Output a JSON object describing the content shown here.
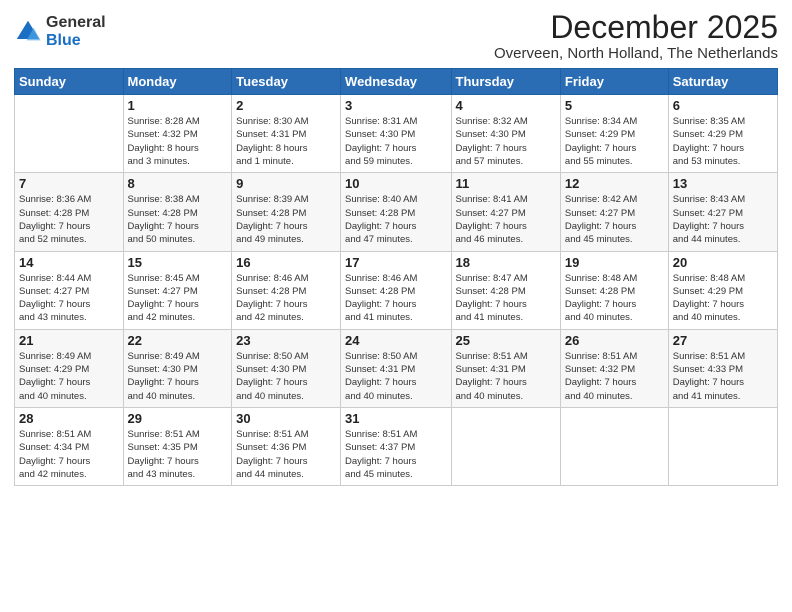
{
  "logo": {
    "general": "General",
    "blue": "Blue"
  },
  "header": {
    "title": "December 2025",
    "location": "Overveen, North Holland, The Netherlands"
  },
  "weekdays": [
    "Sunday",
    "Monday",
    "Tuesday",
    "Wednesday",
    "Thursday",
    "Friday",
    "Saturday"
  ],
  "weeks": [
    [
      {
        "day": "",
        "info": ""
      },
      {
        "day": "1",
        "info": "Sunrise: 8:28 AM\nSunset: 4:32 PM\nDaylight: 8 hours\nand 3 minutes."
      },
      {
        "day": "2",
        "info": "Sunrise: 8:30 AM\nSunset: 4:31 PM\nDaylight: 8 hours\nand 1 minute."
      },
      {
        "day": "3",
        "info": "Sunrise: 8:31 AM\nSunset: 4:30 PM\nDaylight: 7 hours\nand 59 minutes."
      },
      {
        "day": "4",
        "info": "Sunrise: 8:32 AM\nSunset: 4:30 PM\nDaylight: 7 hours\nand 57 minutes."
      },
      {
        "day": "5",
        "info": "Sunrise: 8:34 AM\nSunset: 4:29 PM\nDaylight: 7 hours\nand 55 minutes."
      },
      {
        "day": "6",
        "info": "Sunrise: 8:35 AM\nSunset: 4:29 PM\nDaylight: 7 hours\nand 53 minutes."
      }
    ],
    [
      {
        "day": "7",
        "info": "Sunrise: 8:36 AM\nSunset: 4:28 PM\nDaylight: 7 hours\nand 52 minutes."
      },
      {
        "day": "8",
        "info": "Sunrise: 8:38 AM\nSunset: 4:28 PM\nDaylight: 7 hours\nand 50 minutes."
      },
      {
        "day": "9",
        "info": "Sunrise: 8:39 AM\nSunset: 4:28 PM\nDaylight: 7 hours\nand 49 minutes."
      },
      {
        "day": "10",
        "info": "Sunrise: 8:40 AM\nSunset: 4:28 PM\nDaylight: 7 hours\nand 47 minutes."
      },
      {
        "day": "11",
        "info": "Sunrise: 8:41 AM\nSunset: 4:27 PM\nDaylight: 7 hours\nand 46 minutes."
      },
      {
        "day": "12",
        "info": "Sunrise: 8:42 AM\nSunset: 4:27 PM\nDaylight: 7 hours\nand 45 minutes."
      },
      {
        "day": "13",
        "info": "Sunrise: 8:43 AM\nSunset: 4:27 PM\nDaylight: 7 hours\nand 44 minutes."
      }
    ],
    [
      {
        "day": "14",
        "info": "Sunrise: 8:44 AM\nSunset: 4:27 PM\nDaylight: 7 hours\nand 43 minutes."
      },
      {
        "day": "15",
        "info": "Sunrise: 8:45 AM\nSunset: 4:27 PM\nDaylight: 7 hours\nand 42 minutes."
      },
      {
        "day": "16",
        "info": "Sunrise: 8:46 AM\nSunset: 4:28 PM\nDaylight: 7 hours\nand 42 minutes."
      },
      {
        "day": "17",
        "info": "Sunrise: 8:46 AM\nSunset: 4:28 PM\nDaylight: 7 hours\nand 41 minutes."
      },
      {
        "day": "18",
        "info": "Sunrise: 8:47 AM\nSunset: 4:28 PM\nDaylight: 7 hours\nand 41 minutes."
      },
      {
        "day": "19",
        "info": "Sunrise: 8:48 AM\nSunset: 4:28 PM\nDaylight: 7 hours\nand 40 minutes."
      },
      {
        "day": "20",
        "info": "Sunrise: 8:48 AM\nSunset: 4:29 PM\nDaylight: 7 hours\nand 40 minutes."
      }
    ],
    [
      {
        "day": "21",
        "info": "Sunrise: 8:49 AM\nSunset: 4:29 PM\nDaylight: 7 hours\nand 40 minutes."
      },
      {
        "day": "22",
        "info": "Sunrise: 8:49 AM\nSunset: 4:30 PM\nDaylight: 7 hours\nand 40 minutes."
      },
      {
        "day": "23",
        "info": "Sunrise: 8:50 AM\nSunset: 4:30 PM\nDaylight: 7 hours\nand 40 minutes."
      },
      {
        "day": "24",
        "info": "Sunrise: 8:50 AM\nSunset: 4:31 PM\nDaylight: 7 hours\nand 40 minutes."
      },
      {
        "day": "25",
        "info": "Sunrise: 8:51 AM\nSunset: 4:31 PM\nDaylight: 7 hours\nand 40 minutes."
      },
      {
        "day": "26",
        "info": "Sunrise: 8:51 AM\nSunset: 4:32 PM\nDaylight: 7 hours\nand 40 minutes."
      },
      {
        "day": "27",
        "info": "Sunrise: 8:51 AM\nSunset: 4:33 PM\nDaylight: 7 hours\nand 41 minutes."
      }
    ],
    [
      {
        "day": "28",
        "info": "Sunrise: 8:51 AM\nSunset: 4:34 PM\nDaylight: 7 hours\nand 42 minutes."
      },
      {
        "day": "29",
        "info": "Sunrise: 8:51 AM\nSunset: 4:35 PM\nDaylight: 7 hours\nand 43 minutes."
      },
      {
        "day": "30",
        "info": "Sunrise: 8:51 AM\nSunset: 4:36 PM\nDaylight: 7 hours\nand 44 minutes."
      },
      {
        "day": "31",
        "info": "Sunrise: 8:51 AM\nSunset: 4:37 PM\nDaylight: 7 hours\nand 45 minutes."
      },
      {
        "day": "",
        "info": ""
      },
      {
        "day": "",
        "info": ""
      },
      {
        "day": "",
        "info": ""
      }
    ]
  ]
}
